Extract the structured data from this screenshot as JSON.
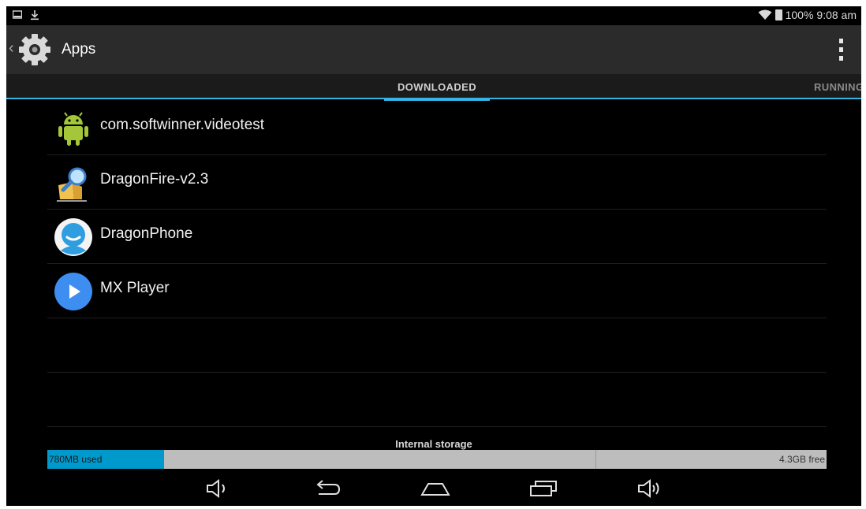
{
  "status_bar": {
    "left_icons": [
      "screen-icon",
      "download-icon"
    ],
    "battery": "100%",
    "time": "9:08 am",
    "right_icons": [
      "wifi-icon",
      "battery-icon"
    ]
  },
  "action_bar": {
    "title": "Apps",
    "icon": "gear-icon",
    "overflow_icon": "overflow-menu-icon"
  },
  "tabs": [
    {
      "label": "DOWNLOADED",
      "selected": true
    },
    {
      "label": "RUNNING",
      "selected": false
    }
  ],
  "apps": [
    {
      "label": "com.softwinner.videotest",
      "icon": "android-icon"
    },
    {
      "label": "DragonFire-v2.3",
      "icon": "dragonfire-icon"
    },
    {
      "label": "DragonPhone",
      "icon": "dragonphone-icon"
    },
    {
      "label": "MX Player",
      "icon": "mxplayer-icon"
    }
  ],
  "storage": {
    "label": "Internal storage",
    "used_text": "780MB used",
    "free_text": "4.3GB free",
    "used_fraction": 0.15
  },
  "nav_bar": {
    "buttons": [
      "volume-down-icon",
      "back-icon",
      "home-icon",
      "recents-icon",
      "volume-up-icon"
    ]
  },
  "colors": {
    "accent": "#33b5e5",
    "storage_used": "#0099cc"
  }
}
